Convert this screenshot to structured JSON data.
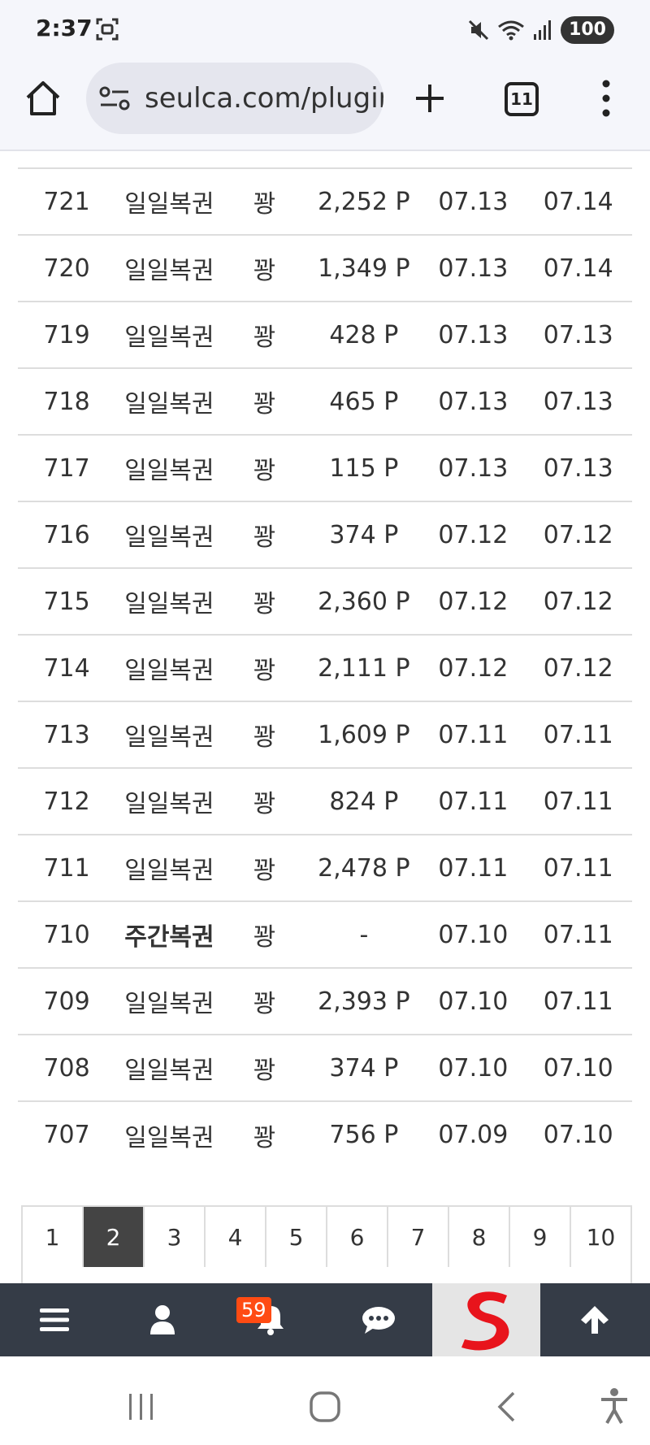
{
  "status_bar": {
    "time": "2:37",
    "battery": "100"
  },
  "browser": {
    "url": "seulca.com/plugin",
    "tab_count": "11"
  },
  "rows": [
    {
      "no": "721",
      "type": "일일복권",
      "user": "꽝",
      "points": "2,252 P",
      "date1": "07.13",
      "date2": "07.14",
      "bold": false
    },
    {
      "no": "720",
      "type": "일일복권",
      "user": "꽝",
      "points": "1,349 P",
      "date1": "07.13",
      "date2": "07.14",
      "bold": false
    },
    {
      "no": "719",
      "type": "일일복권",
      "user": "꽝",
      "points": "428 P",
      "date1": "07.13",
      "date2": "07.13",
      "bold": false
    },
    {
      "no": "718",
      "type": "일일복권",
      "user": "꽝",
      "points": "465 P",
      "date1": "07.13",
      "date2": "07.13",
      "bold": false
    },
    {
      "no": "717",
      "type": "일일복권",
      "user": "꽝",
      "points": "115 P",
      "date1": "07.13",
      "date2": "07.13",
      "bold": false
    },
    {
      "no": "716",
      "type": "일일복권",
      "user": "꽝",
      "points": "374 P",
      "date1": "07.12",
      "date2": "07.12",
      "bold": false
    },
    {
      "no": "715",
      "type": "일일복권",
      "user": "꽝",
      "points": "2,360 P",
      "date1": "07.12",
      "date2": "07.12",
      "bold": false
    },
    {
      "no": "714",
      "type": "일일복권",
      "user": "꽝",
      "points": "2,111 P",
      "date1": "07.12",
      "date2": "07.12",
      "bold": false
    },
    {
      "no": "713",
      "type": "일일복권",
      "user": "꽝",
      "points": "1,609 P",
      "date1": "07.11",
      "date2": "07.11",
      "bold": false
    },
    {
      "no": "712",
      "type": "일일복권",
      "user": "꽝",
      "points": "824 P",
      "date1": "07.11",
      "date2": "07.11",
      "bold": false
    },
    {
      "no": "711",
      "type": "일일복권",
      "user": "꽝",
      "points": "2,478 P",
      "date1": "07.11",
      "date2": "07.11",
      "bold": false
    },
    {
      "no": "710",
      "type": "주간복권",
      "user": "꽝",
      "points": "-",
      "date1": "07.10",
      "date2": "07.11",
      "bold": true
    },
    {
      "no": "709",
      "type": "일일복권",
      "user": "꽝",
      "points": "2,393 P",
      "date1": "07.10",
      "date2": "07.11",
      "bold": false
    },
    {
      "no": "708",
      "type": "일일복권",
      "user": "꽝",
      "points": "374 P",
      "date1": "07.10",
      "date2": "07.10",
      "bold": false
    },
    {
      "no": "707",
      "type": "일일복권",
      "user": "꽝",
      "points": "756 P",
      "date1": "07.09",
      "date2": "07.10",
      "bold": false
    }
  ],
  "pagination": {
    "pages": [
      "1",
      "2",
      "3",
      "4",
      "5",
      "6",
      "7",
      "8",
      "9",
      "10"
    ],
    "active": "2"
  },
  "bottom_nav": {
    "notification_count": "59",
    "dark_color": "#353c47",
    "badge_color": "#ff4b13",
    "logo_color": "#e8141c"
  }
}
